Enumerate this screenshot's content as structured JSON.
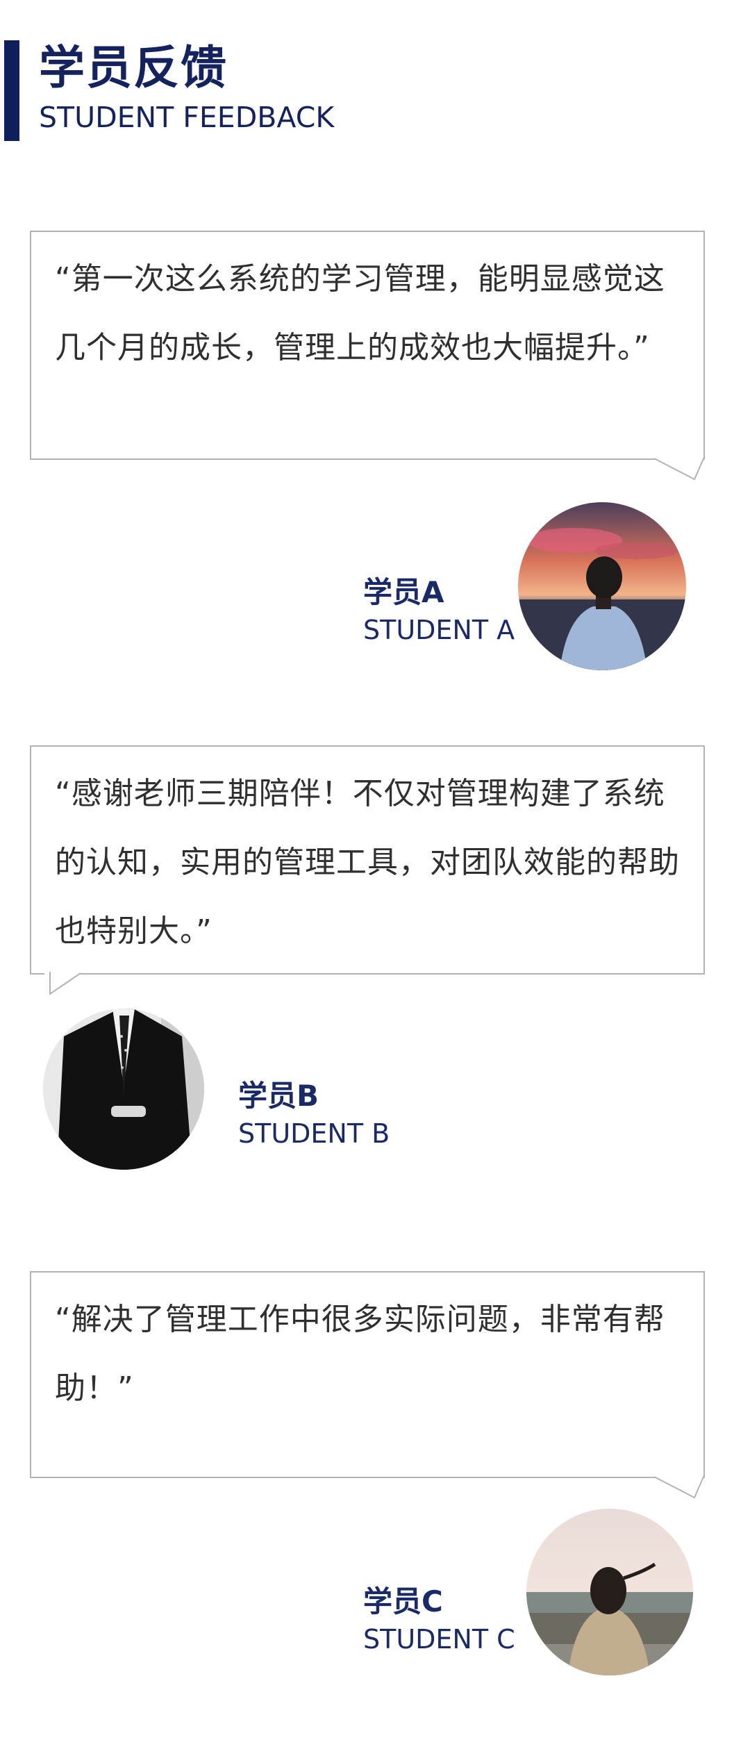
{
  "header": {
    "title": "学员反馈",
    "subtitle": "STUDENT FEEDBACK"
  },
  "feedback": [
    {
      "quote": "“第一次这么系统的学习管理，能明显感觉这几个月的成长，管理上的成效也大幅提升。”",
      "name": "学员A",
      "name_en": "STUDENT A",
      "avatar": "photo-man-at-sunset-sea"
    },
    {
      "quote": "“感谢老师三期陪伴！不仅对管理构建了系统的认知，实用的管理工具，对团队效能的帮助也特别大。”",
      "name": "学员B",
      "name_en": "STUDENT B",
      "avatar": "photo-man-in-suit-bw"
    },
    {
      "quote": "“解决了管理工作中很多实际问题，非常有帮助！”",
      "name": "学员C",
      "name_en": "STUDENT C",
      "avatar": "photo-woman-at-seaside"
    }
  ],
  "colors": {
    "accent": "#14225e",
    "bubble_border": "#b3b3b3",
    "text": "#2f2f2f"
  }
}
